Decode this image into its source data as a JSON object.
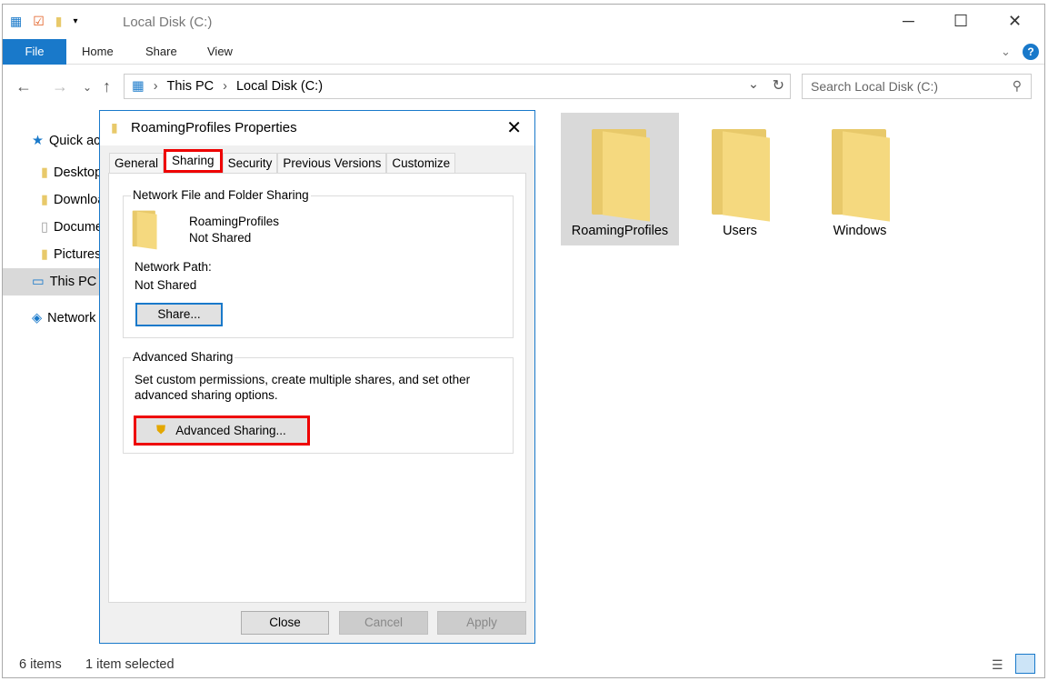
{
  "window": {
    "title": "Local Disk (C:)",
    "minimize": "─",
    "maximize": "☐",
    "close": "✕"
  },
  "ribbon": {
    "tabs": [
      "File",
      "Home",
      "Share",
      "View"
    ],
    "help": "?"
  },
  "address": {
    "crumbs": [
      "This PC",
      "Local Disk (C:)"
    ],
    "search_placeholder": "Search Local Disk (C:)"
  },
  "sidebar": {
    "items": [
      {
        "label": "Quick access",
        "icon": "star-icon"
      },
      {
        "label": "Desktop"
      },
      {
        "label": "Downloads"
      },
      {
        "label": "Documents"
      },
      {
        "label": "Pictures"
      },
      {
        "label": "This PC"
      },
      {
        "label": "Network"
      }
    ]
  },
  "content": {
    "items": [
      {
        "label": "RoamingProfiles",
        "selected": true
      },
      {
        "label": "Users"
      },
      {
        "label": "Windows"
      }
    ]
  },
  "status": {
    "count": "6 items",
    "selected": "1 item selected"
  },
  "dialog": {
    "title": "RoamingProfiles Properties",
    "tabs": [
      "General",
      "Sharing",
      "Security",
      "Previous Versions",
      "Customize"
    ],
    "active_tab": "Sharing",
    "network_group": "Network File and Folder Sharing",
    "folder_name": "RoamingProfiles",
    "share_state": "Not Shared",
    "network_path_label": "Network Path:",
    "network_path": "Not Shared",
    "share_button": "Share...",
    "advanced_group": "Advanced Sharing",
    "advanced_desc1": "Set custom permissions, create multiple shares, and set other",
    "advanced_desc2": "advanced sharing options.",
    "advanced_button": "Advanced Sharing...",
    "close": "Close",
    "cancel": "Cancel",
    "apply": "Apply"
  },
  "colors": {
    "accent": "#1979ca",
    "highlight": "#e00000",
    "folder": "#f5d97f"
  }
}
